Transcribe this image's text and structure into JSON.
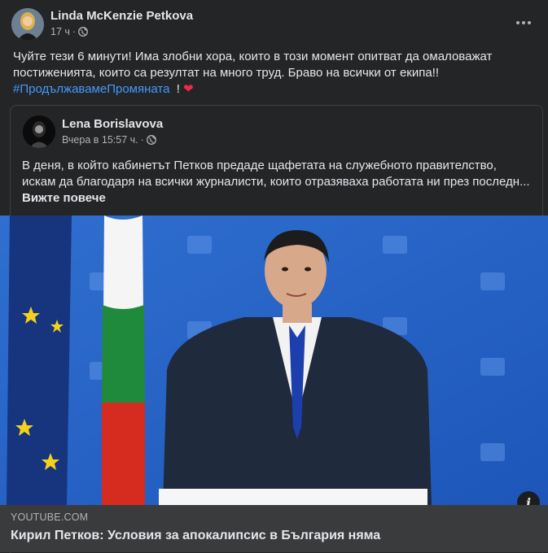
{
  "post": {
    "author": "Linda McKenzie Petkova",
    "time": "17 ч",
    "separator": "·",
    "text": "Чуйте тези 6 минути! Има злобни хора, които в този момент опитват да омаловажат постиженията, които са резултат на много труд. Браво на всички от екипа!!",
    "hashtag": "#ПродължавамеПромяната",
    "tail": "!",
    "heart": "❤",
    "more_icon": "more-horizontal-icon",
    "privacy_icon": "globe-icon"
  },
  "shared": {
    "author": "Lena Borislavova",
    "time": "Вчера в 15:57 ч.",
    "separator": "·",
    "text": "В деня, в който кабинетът Петков предаде щафетата на служебното правителство, искам да благодаря на всички журналисти, които отразяваха работата ни през последн...",
    "see_more": "Вижте повече"
  },
  "video": {
    "info_icon": "info-icon",
    "info_glyph": "i"
  },
  "link": {
    "domain": "YOUTUBE.COM",
    "title": "Кирил Петков: Условия за апокалипсис в България няма"
  },
  "colors": {
    "background": "#242526",
    "text": "#e4e6eb",
    "secondary_text": "#b0b3b8",
    "hashtag": "#4599ff",
    "link_bar": "#3a3b3c"
  }
}
